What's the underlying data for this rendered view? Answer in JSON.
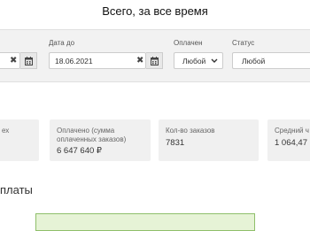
{
  "header": {
    "title": "Всего, за все время"
  },
  "filters": {
    "date_from_value": "21",
    "date_to_label": "Дата до",
    "date_to_value": "18.06.2021",
    "paid_label": "Оплачен",
    "paid_value": "Любой",
    "status_label": "Статус",
    "status_value": "Любой",
    "clear_glyph": "✖"
  },
  "cards": [
    {
      "label": "ех",
      "value": ""
    },
    {
      "label": "Оплачено (сумма оплаченных заказов)",
      "value": "6 647 640 ₽"
    },
    {
      "label": "Кол-во заказов",
      "value": "7831"
    },
    {
      "label": "Средний ч",
      "value": "1 064,47"
    }
  ],
  "section": {
    "title": "платы"
  },
  "colors": {
    "chart_fill": "#e6f3d6",
    "chart_border": "#8fbf6a",
    "filter_bg": "#f2f2f2",
    "card_bg": "#f0f0f0"
  }
}
